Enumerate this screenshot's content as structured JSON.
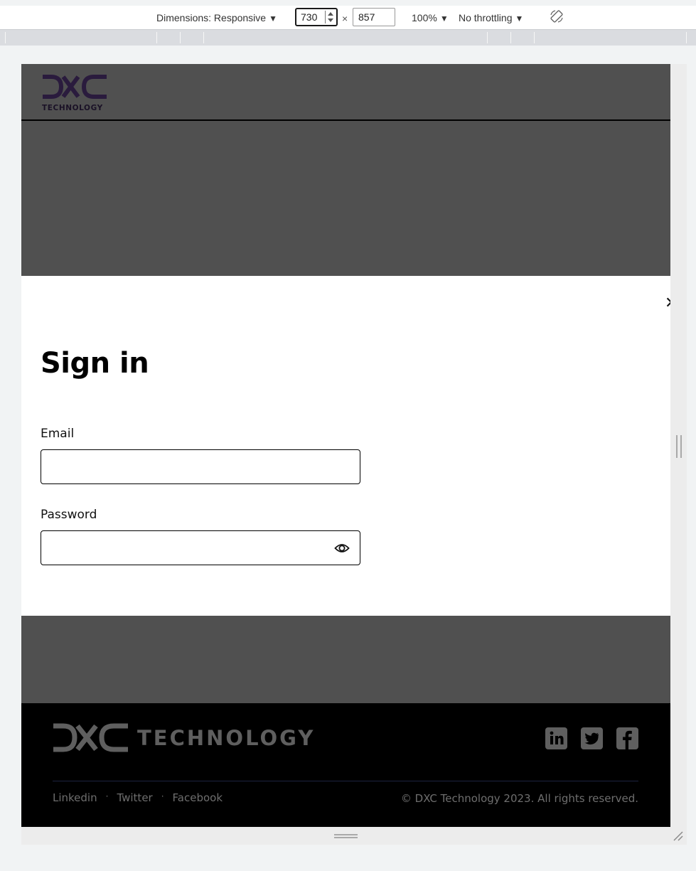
{
  "devtools": {
    "dimensions_label": "Dimensions: Responsive",
    "width_value": "730",
    "times": "×",
    "height_value": "857",
    "zoom": "100%",
    "throttling": "No throttling",
    "caret": "▼",
    "rotate_icon": "rotate-device-icon"
  },
  "site_header": {
    "logo_icon": "dxc-logo-icon",
    "logo_text": "TECHNOLOGY",
    "logo_color": "#2a1b3d"
  },
  "modal": {
    "close_icon": "close-icon",
    "close_glyph": "✕",
    "title": "Sign in",
    "email_label": "Email",
    "email_value": "",
    "password_label": "Password",
    "password_value": "",
    "password_toggle_icon": "eye-icon"
  },
  "footer": {
    "logo_icon": "dxc-logo-icon",
    "logo_text": "TECHNOLOGY",
    "social": [
      {
        "icon": "linkedin-icon"
      },
      {
        "icon": "twitter-icon"
      },
      {
        "icon": "facebook-icon"
      }
    ],
    "links": [
      "Linkedin",
      "Twitter",
      "Facebook"
    ],
    "separator": "·",
    "copyright": "© DXC Technology 2023. All rights reserved."
  },
  "colors": {
    "page_background": "#505050",
    "modal_background": "#ffffff",
    "footer_background": "#000000",
    "footer_text": "#6e6e6e"
  }
}
